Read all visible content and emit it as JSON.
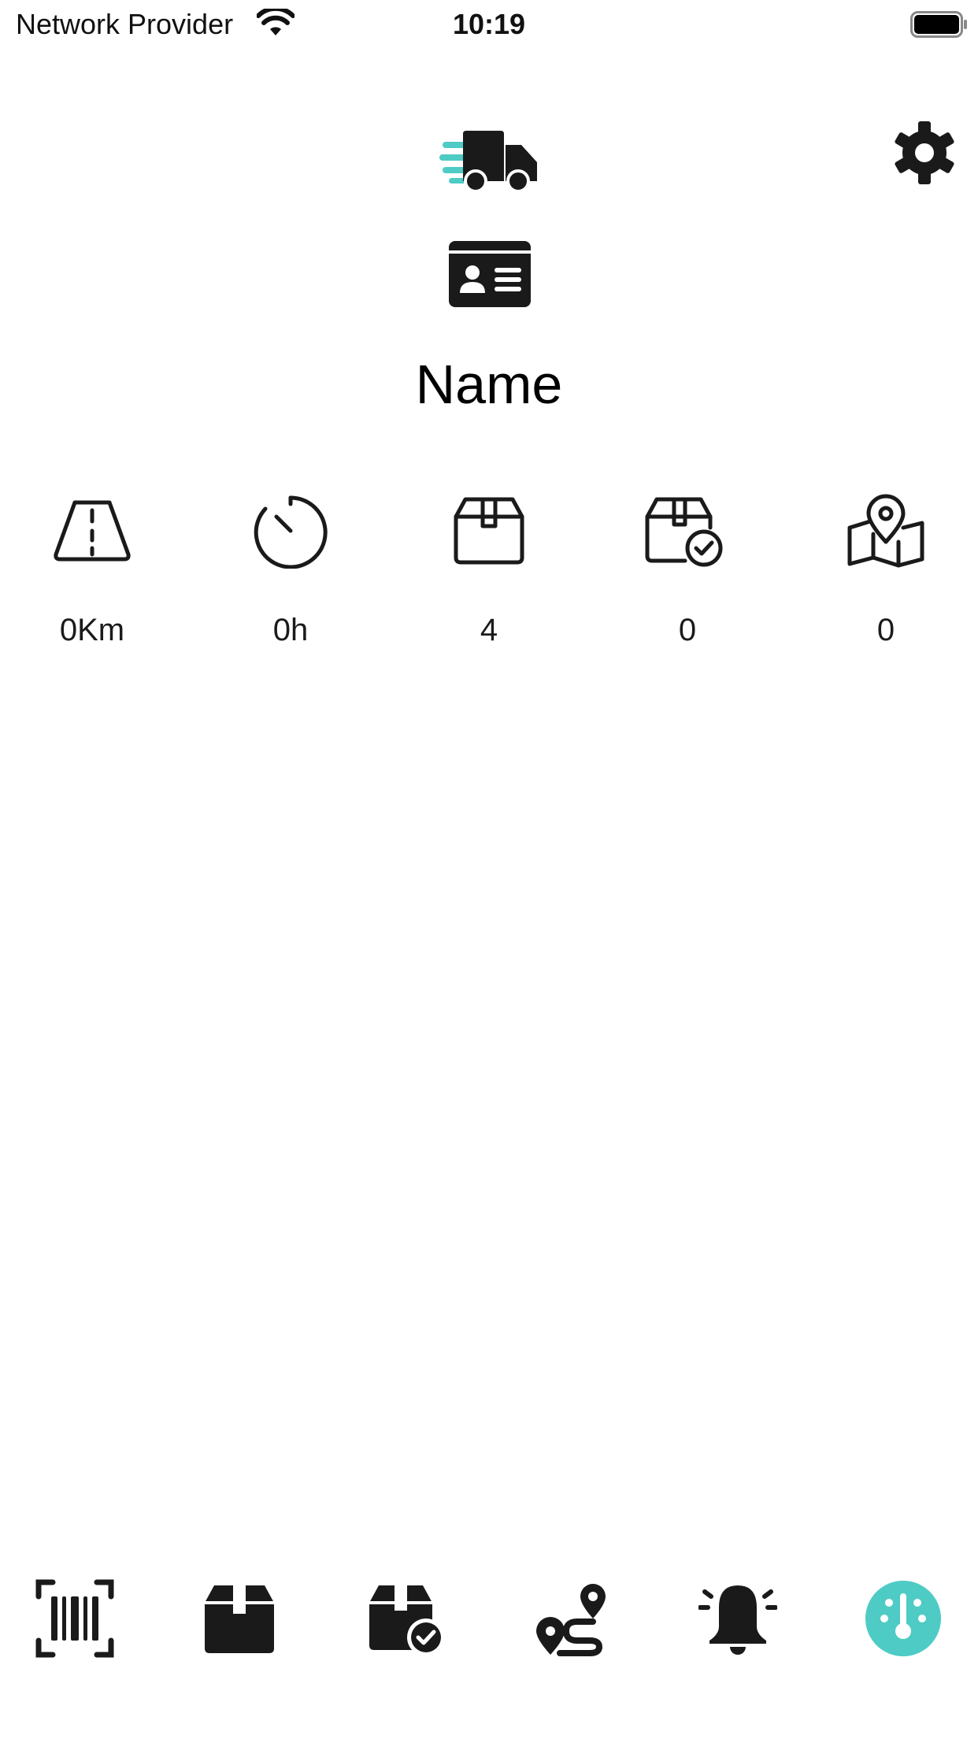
{
  "status_bar": {
    "provider": "Network Provider",
    "time": "10:19"
  },
  "header": {
    "name": "Name"
  },
  "stats": [
    {
      "icon": "road-icon",
      "value": "0Km"
    },
    {
      "icon": "timer-icon",
      "value": "0h"
    },
    {
      "icon": "package-icon",
      "value": "4"
    },
    {
      "icon": "package-delivered-icon",
      "value": "0"
    },
    {
      "icon": "map-pin-icon",
      "value": "0"
    }
  ],
  "tabs": [
    {
      "icon": "barcode-scan-icon"
    },
    {
      "icon": "box-icon"
    },
    {
      "icon": "box-check-icon"
    },
    {
      "icon": "route-icon"
    },
    {
      "icon": "alarm-bell-icon"
    },
    {
      "icon": "dashboard-gauge-icon",
      "active": true
    }
  ],
  "colors": {
    "accent": "#4ecbc4",
    "icon": "#1a1a1a",
    "background": "#ffffff"
  }
}
